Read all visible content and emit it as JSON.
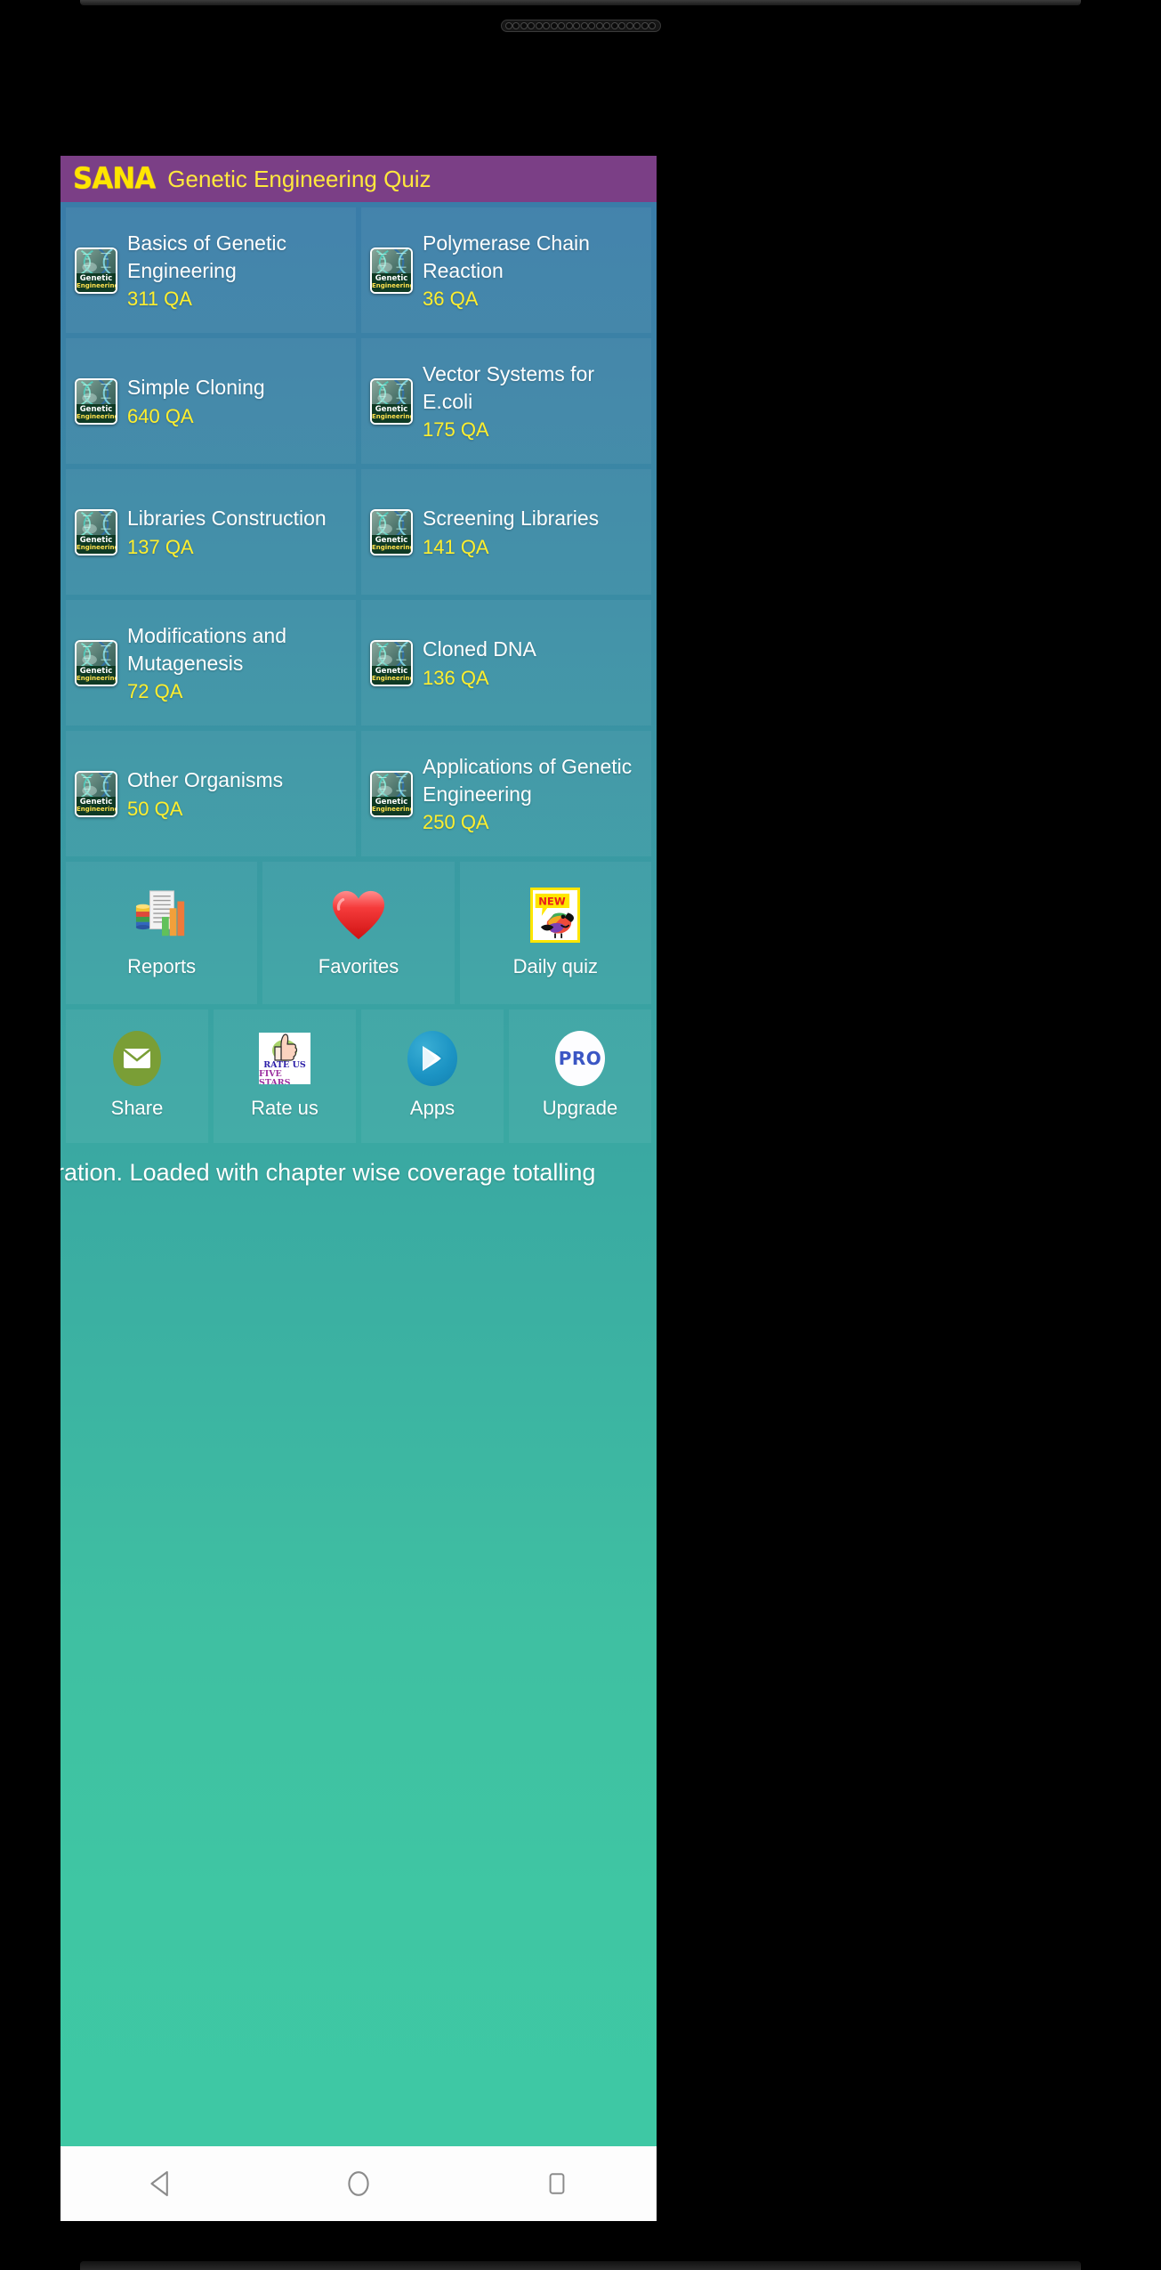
{
  "header": {
    "brand": "SANA",
    "title": "Genetic Engineering Quiz",
    "brand_color": "#ffe500",
    "title_color": "#ffe83d",
    "background_color": "#7b3f86"
  },
  "theme": {
    "gradient_top": "#3a7ca8",
    "gradient_bottom": "#3ec9a4",
    "tile_text_color": "#ffffff",
    "count_color": "#ffef2e"
  },
  "chapter_icon": {
    "caption_line1": "Genetic",
    "caption_line2": "Engineering",
    "name": "dna-helix-icon"
  },
  "chapters": [
    {
      "title": "Basics of Genetic Engineering",
      "count": "311 QA"
    },
    {
      "title": "Polymerase Chain Reaction",
      "count": "36 QA"
    },
    {
      "title": "Simple Cloning",
      "count": "640 QA"
    },
    {
      "title": "Vector Systems for E.coli",
      "count": "175 QA"
    },
    {
      "title": "Libraries Construction",
      "count": "137 QA"
    },
    {
      "title": "Screening Libraries",
      "count": "141 QA"
    },
    {
      "title": "Modifications and Mutagenesis",
      "count": "72 QA"
    },
    {
      "title": "Cloned DNA",
      "count": "136 QA"
    },
    {
      "title": "Other Organisms",
      "count": "50 QA"
    },
    {
      "title": "Applications of Genetic Engineering",
      "count": "250 QA"
    }
  ],
  "action_row_primary": [
    {
      "label": "Reports",
      "icon": "reports-chart-icon"
    },
    {
      "label": "Favorites",
      "icon": "heart-icon"
    },
    {
      "label": "Daily quiz",
      "icon": "new-bird-icon",
      "badge": "NEW"
    }
  ],
  "action_row_secondary": [
    {
      "label": "Share",
      "icon": "envelope-icon"
    },
    {
      "label": "Rate us",
      "icon": "thumbs-up-icon",
      "line1": "RATE US",
      "line2": "FIVE STARS"
    },
    {
      "label": "Apps",
      "icon": "play-store-icon"
    },
    {
      "label": "Upgrade",
      "icon": "pro-badge-icon",
      "badge": "PRO"
    }
  ],
  "marquee": {
    "text": "aration. Loaded with chapter wise coverage totalling"
  },
  "android_nav": {
    "back": "back-triangle",
    "home": "home-circle",
    "recents": "recents-square"
  }
}
